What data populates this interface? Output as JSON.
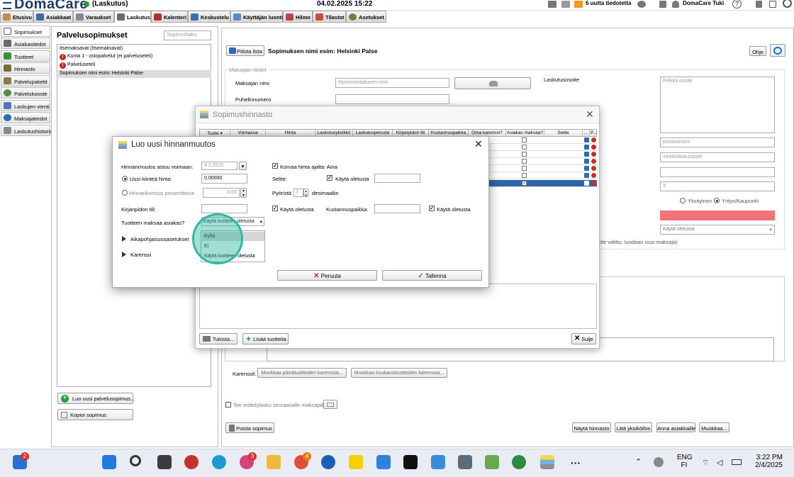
{
  "topbar": {
    "brand": "DomaCare",
    "context": "(Laskutus)",
    "datetime": "04.02.2025 15:22",
    "notifications": "6 uutta tiedotetta",
    "user": "DomaCare Tuki"
  },
  "menu": [
    "Etusivu",
    "Asiakkaat",
    "Varaukset",
    "Laskutus",
    "Kalenteri",
    "Keskustelu",
    "Käyttäjän luonti",
    "Hilmo",
    "Tilastot",
    "Asetukset"
  ],
  "sidenav": [
    "Sopimukset",
    "Asiakastiedot",
    "Tuotteet",
    "Hinnasto",
    "Palvelupaketit",
    "Palvelukooste",
    "Laskujen vienti",
    "Maksajatiedot",
    "Laskutushistoria"
  ],
  "left": {
    "title": "Palvelusopimukset",
    "search_placeholder": "Sopimushaku",
    "items": [
      "Itsemaksavat  (Itsemaksavat)",
      "Kunta 1 - ostopalvelut (ei palveluseteli)",
      "Palveluseteli",
      "Sopimuksen nimi esim: Helsinki Palse"
    ],
    "new_btn": "Luo uusi palvelusopimus...",
    "copy_btn": "Kopioi sopimus"
  },
  "main": {
    "hide_btn": "Piilota lista",
    "title": "Sopimuksen nimi esim: Helsinki Palse",
    "help_btn": "Ohje",
    "payer_section": "Maksajan tiedot",
    "payer_name_label": "Maksajan nimi",
    "payer_name_placeholder": "Hyvinvointialueen nimi",
    "phone_label": "Puhelinnumero",
    "billing_address_label": "Laskutusosoite",
    "address_placeholder": "Pelkkä osoite",
    "postal_placeholder": "postinumero",
    "e_address_placeholder": "verkkolaskuosoite",
    "field9": "9",
    "radio_private": "Yksityinen",
    "radio_company": "Yritys/Kaupunki",
    "default_select": "Käytä oletusta",
    "hint": "ole valittu, luodaan uusi maksaja)",
    "grace_label": "Karenssit:",
    "grace_daily_btn": "Muokkaa päivätuotteiden karenssia...",
    "grace_monthly_btn": "Muokkaa kuukausituotteiden karenssia...",
    "itemized_label": "Tee erittelylasku seuraavalle maksajalle",
    "delete_btn": "Poista sopimus",
    "show_prices_btn": "Näytä hinnasto",
    "merge_btn": "Liitä yksiköihin",
    "assign_btn": "Anna asiakkaille",
    "edit_btn": "Muokkaa..."
  },
  "pricelist": {
    "title": "Sopimushinnasto",
    "columns": [
      "Tuote",
      "Voimassa",
      "Hinta",
      "Laskutusyksikkö",
      "Laskutusperuste",
      "Kirjanpidon tili",
      "Kustannuspaikka",
      "Oma karenssi?",
      "Asiakas maksaa?",
      "Selite",
      "...",
      "P..."
    ],
    "print_btn": "Tulosta...",
    "add_btn": "Lisää tuotteita",
    "close_btn": "Sulje"
  },
  "newprice": {
    "title": "Luo uusi hinnanmuutos",
    "effective_label": "Hinnanmuutos astuu voimaan:",
    "effective_value": "4.2.2025",
    "replace_label": "Korvaa hinta ajalta: Aina",
    "fixed_label": "Uusi kiinteä hinta:",
    "fixed_value": "0,00000",
    "pct_label": "Hinnankorotus prosentteina:",
    "pct_value": "0,00",
    "desc_label": "Selite:",
    "use_default": "Käytä oletusta",
    "round_label": "Pyöristä",
    "round_value": "3",
    "decimals_label": "desimaaliin",
    "account_label": "Kirjanpidon tili:",
    "cost_label": "Kustannuspaikka:",
    "customer_pays_label": "Tuotteen maksaa asiakas?",
    "customer_pays_value": "Käytä tuotteen oletusta",
    "options": [
      "Kyllä",
      "Ei",
      "Käytä tuotteen oletusta"
    ],
    "template_label": "Aikapohjaisuusasetukset",
    "grace_label": "Karenssi",
    "cancel_btn": "Peruuta",
    "save_btn": "Tallenna"
  },
  "taskbar": {
    "lang": "ENG",
    "region": "FI",
    "time": "3:22 PM",
    "date": "2/4/2025",
    "badge_left": "2",
    "badge_a": "3",
    "badge_b": "4"
  },
  "colors": {
    "accent": "#2a6db3",
    "error": "#c8201a",
    "spotlight": "#2fb8a4"
  }
}
